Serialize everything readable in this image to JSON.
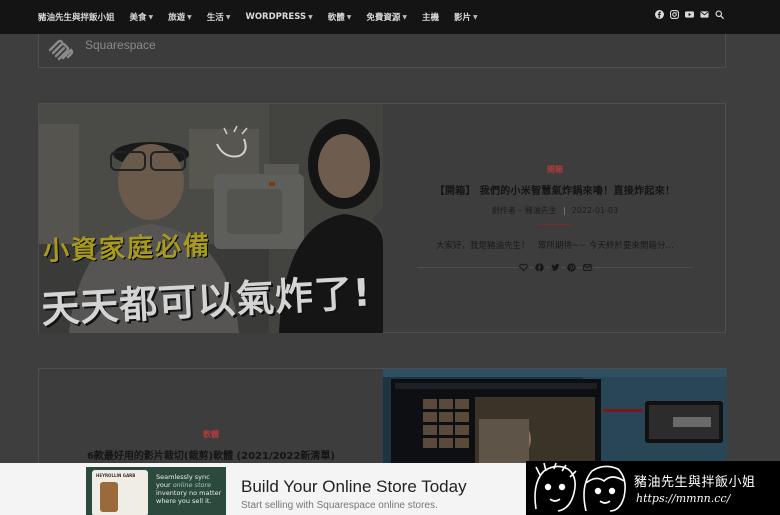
{
  "nav": {
    "items": [
      {
        "label": "豬油先生與拌飯小姐",
        "has_menu": false
      },
      {
        "label": "美食",
        "has_menu": true
      },
      {
        "label": "旅遊",
        "has_menu": true
      },
      {
        "label": "生活",
        "has_menu": true
      },
      {
        "label": "WORDPRESS",
        "has_menu": true
      },
      {
        "label": "軟體",
        "has_menu": true
      },
      {
        "label": "免費資源",
        "has_menu": true
      },
      {
        "label": "主機",
        "has_menu": false
      },
      {
        "label": "影片",
        "has_menu": true
      }
    ],
    "social_icons": [
      "facebook-icon",
      "instagram-icon",
      "youtube-icon",
      "email-icon",
      "search-icon"
    ]
  },
  "sponsor": {
    "name": "Squarespace"
  },
  "posts": [
    {
      "category": "開箱",
      "title": "【開箱】 我們的小米智慧氣炸鍋來嚕！直接炸起來！",
      "author": "創作者 – 豬油先生",
      "date": "2022-01-03",
      "excerpt": "大家好，我是豬油先生！　眾所期待~~ 今天終於要來開箱分…",
      "thumb_text_top": "小資家庭必備",
      "thumb_text_bottom": "天天都可以氣炸了!",
      "share_icons": [
        "heart-icon",
        "facebook-icon",
        "twitter-icon",
        "pinterest-icon",
        "email-icon"
      ]
    },
    {
      "category": "軟體",
      "title": "6款最好用的影片裁切(裁剪)軟體 (2021/2022新清單)"
    }
  ],
  "ad": {
    "title": "Build Your Online Store Today",
    "subtitle": "Start selling with Squarespace online stores.",
    "image_brand": "HEYROLLIN GARB",
    "image_slogan_1": "Seamlessly sync your",
    "image_slogan_em": "online store",
    "image_slogan_2": "inventory no matter where you sell it."
  },
  "watermark": {
    "title": "豬油先生與拌飯小姐",
    "url": "https://mmnn.cc/"
  }
}
